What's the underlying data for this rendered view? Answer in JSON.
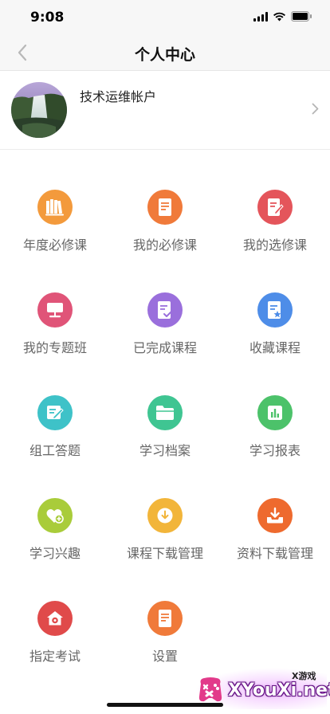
{
  "status_bar": {
    "time": "9:08",
    "icons": [
      "signal-icon",
      "wifi-icon",
      "battery-icon"
    ]
  },
  "nav": {
    "title": "个人中心",
    "back_icon": "chevron-left-icon"
  },
  "profile": {
    "name": "技术运维帐户",
    "chevron_icon": "chevron-right-icon"
  },
  "grid": {
    "items": [
      {
        "label": "年度必修课",
        "icon": "books-icon",
        "color": "#f39a3c"
      },
      {
        "label": "我的必修课",
        "icon": "document-icon",
        "color": "#f07a3a"
      },
      {
        "label": "我的选修课",
        "icon": "edit-document-icon",
        "color": "#e4555b"
      },
      {
        "label": "我的专题班",
        "icon": "presentation-icon",
        "color": "#e05478"
      },
      {
        "label": "已完成课程",
        "icon": "checked-document-icon",
        "color": "#9a6fdc"
      },
      {
        "label": "收藏课程",
        "icon": "star-document-icon",
        "color": "#4e8de8"
      },
      {
        "label": "组工答题",
        "icon": "answer-sheet-icon",
        "color": "#3ec2c8"
      },
      {
        "label": "学习档案",
        "icon": "folder-icon",
        "color": "#3fc592"
      },
      {
        "label": "学习报表",
        "icon": "bar-chart-icon",
        "color": "#4cc26a"
      },
      {
        "label": "学习兴趣",
        "icon": "heart-plus-icon",
        "color": "#a9cc3a"
      },
      {
        "label": "课程下载管理",
        "icon": "download-circle-icon",
        "color": "#f2b53a"
      },
      {
        "label": "资料下载管理",
        "icon": "download-tray-icon",
        "color": "#ee6a2e"
      },
      {
        "label": "指定考试",
        "icon": "house-target-icon",
        "color": "#e04a4a"
      },
      {
        "label": "设置",
        "icon": "settings-document-icon",
        "color": "#f07a3a"
      }
    ]
  },
  "watermark": {
    "small_text": "X游戏",
    "big_text": "XYouXi.net"
  }
}
